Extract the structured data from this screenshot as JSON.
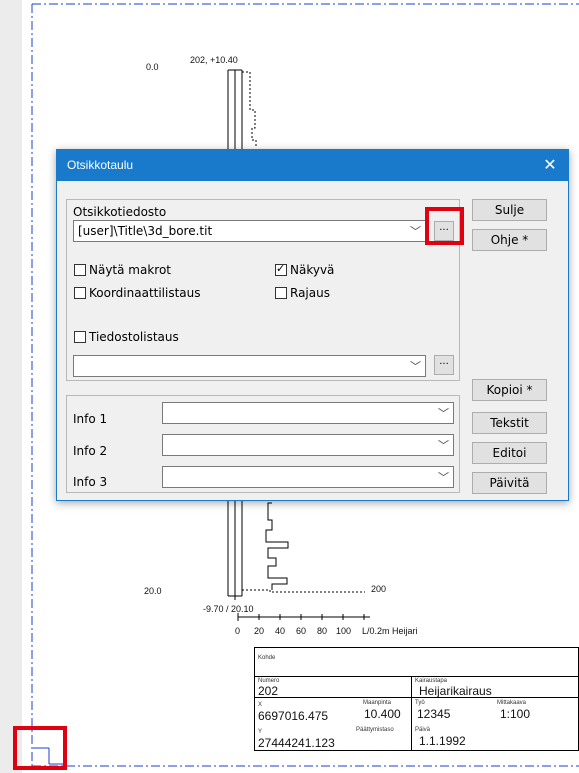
{
  "drawing": {
    "top_depth": "0.0",
    "top_label": "202, +10.40",
    "bottom_depth": "20.0",
    "bottom_label": "-9.70 / 20.10",
    "curve_end_label": "200",
    "axis_ticks": [
      "0",
      "20",
      "40",
      "60",
      "80",
      "100"
    ],
    "axis_caption": "L/0.2m Heijari"
  },
  "title_block": {
    "kohde_label": "Kohde",
    "numero_label": "Numero",
    "numero_value": "202",
    "kairaustapa_label": "Kairaustapa",
    "kairaustapa_value": "Heijarikairaus",
    "x_label": "X",
    "x_value": "6697016.475",
    "maanpinta_label": "Maanpinta",
    "maanpinta_value": "10.400",
    "tyo_label": "Työ",
    "tyo_value": "12345",
    "mittakaava_label": "Mittakaava",
    "mittakaava_value": "1:100",
    "y_label": "Y",
    "y_value": "27444241.123",
    "paattymistaso_label": "Päättymistaso",
    "paiva_label": "Päivä",
    "paiva_value": "1.1.1992"
  },
  "dialog": {
    "title": "Otsikkotaulu",
    "close_glyph": "✕",
    "file_group_label": "Otsikkotiedosto",
    "file_value": "[user]\\Title\\3d_bore.tit",
    "browse_label": "...",
    "checkboxes": {
      "nayta_makrot": "Näytä makrot",
      "nakyva": "Näkyvä",
      "koordinaatti": "Koordinaattilistaus",
      "rajaus": "Rajaus",
      "tiedosto": "Tiedostolistaus"
    },
    "info_labels": [
      "Info 1",
      "Info 2",
      "Info 3"
    ],
    "buttons": {
      "sulje": "Sulje",
      "ohje": "Ohje *",
      "kopioi": "Kopioi *",
      "tekstit": "Tekstit",
      "editoi": "Editoi",
      "paivita": "Päivitä"
    },
    "nakyva_checked": true
  },
  "colors": {
    "accent": "#1979ca",
    "highlight": "#e0000f",
    "frame_dash": "#1a3fd0"
  }
}
